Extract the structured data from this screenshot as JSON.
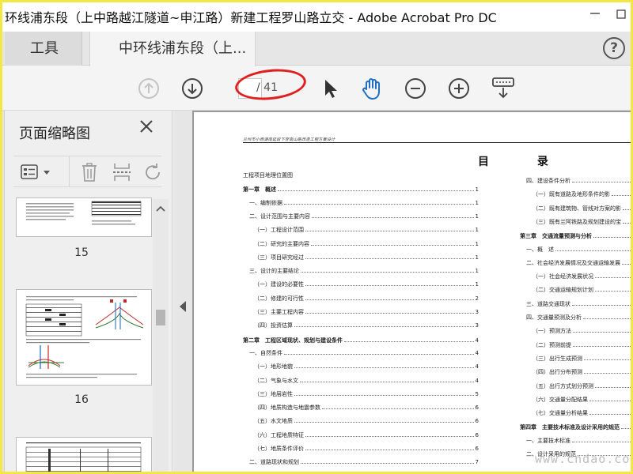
{
  "window": {
    "title": "环线浦东段（上中路越江隧道~申江路）新建工程罗山路立交 - Adobe Acrobat Pro DC"
  },
  "tabs": {
    "tools": "工具",
    "document": "中环线浦东段（上..."
  },
  "toolbar": {
    "current_page": "",
    "page_total": "/ 41"
  },
  "thumbnails": {
    "title": "页面缩略图",
    "pages": [
      {
        "number": "15"
      },
      {
        "number": "16"
      }
    ]
  },
  "document": {
    "header": "兰州市小西湖南延段下穿南山路改造工程方案设计",
    "toc_title": "目 录",
    "left_col": [
      {
        "t": "工程项目地理位置图",
        "p": "",
        "kind": "plain"
      },
      {
        "t": "第一章　概述",
        "p": "1",
        "kind": "ch"
      },
      {
        "t": "一、编制依据",
        "p": "1",
        "kind": "l1"
      },
      {
        "t": "二、设计范围与主要内容",
        "p": "1",
        "kind": "l1"
      },
      {
        "t": "（一）工程设计范围",
        "p": "1",
        "kind": "l2"
      },
      {
        "t": "（二）研究的主要内容",
        "p": "1",
        "kind": "l2"
      },
      {
        "t": "（三）项目研究经过",
        "p": "1",
        "kind": "l2"
      },
      {
        "t": "三、设计的主要结论",
        "p": "1",
        "kind": "l1"
      },
      {
        "t": "（一）建设的必要性",
        "p": "1",
        "kind": "l2"
      },
      {
        "t": "（二）修建的可行性",
        "p": "2",
        "kind": "l2"
      },
      {
        "t": "（三）主要工程内容",
        "p": "3",
        "kind": "l2"
      },
      {
        "t": "（四）投资估算",
        "p": "3",
        "kind": "l2"
      },
      {
        "t": "第二章　工程区域现状、规划与建设条件",
        "p": "4",
        "kind": "ch"
      },
      {
        "t": "一、自然条件",
        "p": "4",
        "kind": "l1"
      },
      {
        "t": "（一）地形地貌",
        "p": "4",
        "kind": "l2"
      },
      {
        "t": "（二）气象与水文",
        "p": "4",
        "kind": "l2"
      },
      {
        "t": "（三）地层岩性",
        "p": "5",
        "kind": "l2"
      },
      {
        "t": "（四）地质构造与地震参数",
        "p": "6",
        "kind": "l2"
      },
      {
        "t": "（五）水文地质",
        "p": "6",
        "kind": "l2"
      },
      {
        "t": "（六）工程地质特征",
        "p": "6",
        "kind": "l2"
      },
      {
        "t": "（七）地质条件评价",
        "p": "6",
        "kind": "l2"
      },
      {
        "t": "二、道路现状和规划",
        "p": "7",
        "kind": "l1"
      }
    ],
    "right_col": [
      {
        "t": "四、建设条件分析",
        "p": "",
        "kind": "l1"
      },
      {
        "t": "（一）既有道路及地形条件的影",
        "p": "",
        "kind": "l2"
      },
      {
        "t": "（二）既有建筑物、管线对方案的影",
        "p": "",
        "kind": "l2"
      },
      {
        "t": "（三）既有兰阿铁路及规划建设的宝",
        "p": "",
        "kind": "l2"
      },
      {
        "t": "第三章　交通流量预测与分析",
        "p": "",
        "kind": "ch"
      },
      {
        "t": "一、概　述",
        "p": "",
        "kind": "l1"
      },
      {
        "t": "二、社会经济发展情况及交通运输发展",
        "p": "",
        "kind": "l1"
      },
      {
        "t": "（一）社会经济发展状况",
        "p": "",
        "kind": "l2"
      },
      {
        "t": "（二）交通运输规划计划",
        "p": "",
        "kind": "l2"
      },
      {
        "t": "三、道路交通现状",
        "p": "",
        "kind": "l1"
      },
      {
        "t": "四、交通量预测及分析",
        "p": "",
        "kind": "l1"
      },
      {
        "t": "（一）预测方法",
        "p": "",
        "kind": "l2"
      },
      {
        "t": "（二）预测前提",
        "p": "",
        "kind": "l2"
      },
      {
        "t": "（三）出行生成预测",
        "p": "",
        "kind": "l2"
      },
      {
        "t": "（四）出行分布预测",
        "p": "",
        "kind": "l2"
      },
      {
        "t": "（五）出行方式划分预测",
        "p": "",
        "kind": "l2"
      },
      {
        "t": "（六）交通量分配结果",
        "p": "",
        "kind": "l2"
      },
      {
        "t": "（七）交通量分析结果",
        "p": "",
        "kind": "l2"
      },
      {
        "t": "第四章　主要技术标准及设计采用的规范",
        "p": "",
        "kind": "ch"
      },
      {
        "t": "一、主要技术标准",
        "p": "",
        "kind": "l1"
      },
      {
        "t": "二、设计采用的规范",
        "p": "",
        "kind": "l1"
      }
    ]
  },
  "watermark": "www.cndao.com"
}
